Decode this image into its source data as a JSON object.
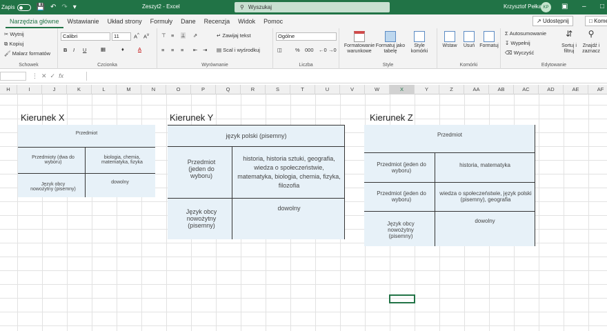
{
  "titlebar": {
    "autosave": "Zapis",
    "doc_title": "Zeszyt2  -  Excel",
    "search_placeholder": "Wyszukaj",
    "user": "Krzysztof Pełka",
    "avatar": "KP"
  },
  "tabs": [
    "Narzędzia główne",
    "Wstawianie",
    "Układ strony",
    "Formuły",
    "Dane",
    "Recenzja",
    "Widok",
    "Pomoc"
  ],
  "active_tab": "Narzędzia główne",
  "share_label": "Udostępnij",
  "comments_label": "Kome",
  "ribbon": {
    "clipboard": {
      "cut": "Wytnij",
      "copy": "Kopiuj",
      "painter": "Malarz formatów",
      "label": "Schowek"
    },
    "font": {
      "name": "Calibri",
      "size": "11",
      "label": "Czcionka"
    },
    "alignment": {
      "wrap": "Zawijaj tekst",
      "merge": "Scal i wyśrodkuj",
      "label": "Wyrównanie"
    },
    "number": {
      "format": "Ogólne",
      "label": "Liczba"
    },
    "styles": {
      "cond": "Formatowanie warunkowe",
      "table": "Formatuj jako tabelę",
      "cell": "Style komórki",
      "label": "Style"
    },
    "cells": {
      "insert": "Wstaw",
      "delete": "Usuń",
      "format": "Formatuj",
      "label": "Komórki"
    },
    "editing": {
      "autosum": "Autosumowanie",
      "fill": "Wypełnij",
      "clear": "Wyczyść",
      "sort": "Sortuj i filtruj",
      "find": "Znajdź i zaznacz",
      "label": "Edytowanie"
    }
  },
  "formula_bar": {
    "fx": "fx"
  },
  "columns": [
    "H",
    "I",
    "J",
    "K",
    "L",
    "M",
    "N",
    "O",
    "P",
    "Q",
    "R",
    "S",
    "T",
    "U",
    "V",
    "W",
    "X",
    "Y",
    "Z",
    "AA",
    "AB",
    "AC",
    "AD",
    "AE",
    "AF"
  ],
  "selected_column": "X",
  "sections": {
    "x": {
      "heading": "Kierunek X",
      "header": "Przedmiot",
      "row1_left": "Przedmioty (dwa do wyboru)",
      "row1_right": "biologia, chemia, matematyka, fizyka",
      "row2_left": "Język obcy nowożytny (pisemny)",
      "row2_right": "dowolny"
    },
    "y": {
      "heading": "Kierunek Y",
      "header": "język polski (pisemny)",
      "row1_left": "Przedmiot (jeden do wyboru)",
      "row1_right": "historia, historia sztuki, geografia, wiedza o społeczeństwie, matematyka, biologia, chemia, fizyka, filozofia",
      "row2_left": "Język obcy nowożytny (pisemny)",
      "row2_right": "dowolny"
    },
    "z": {
      "heading": "Kierunek Z",
      "header": "Przedmiot",
      "row1_left": "Przedmiot (jeden do wyboru)",
      "row1_right": "historia, matematyka",
      "row2_left": "Przedmiot (jeden do wyboru)",
      "row2_right": "wiedza o społeczeństwie, język polski (pisemny), geografia",
      "row3_left": "Język obcy nowożytny (pisemny)",
      "row3_right": "dowolny"
    }
  }
}
